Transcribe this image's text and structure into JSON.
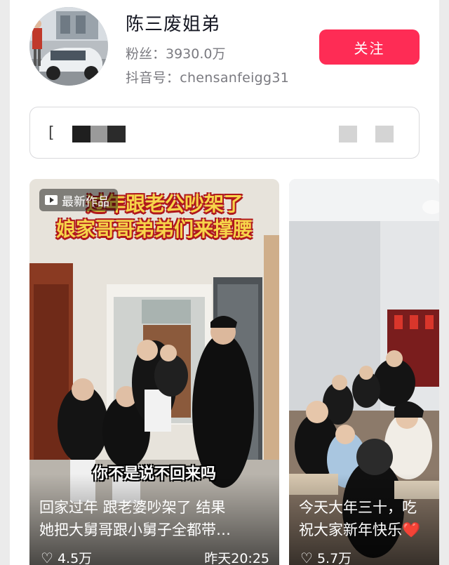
{
  "profile": {
    "nickname": "陈三废姐弟",
    "fans": "粉丝：3930.0万",
    "douyin_id": "抖音号：chensanfeigg31",
    "follow_label": "关注"
  },
  "notice": {
    "bracket": "[",
    "colors": [
      "#1f1f1f",
      "#9a9a9a",
      "#2b2b2b"
    ]
  },
  "videos": [
    {
      "badge": "最新作品",
      "title_line1": "过年跟老公吵架了",
      "title_line2": "娘家哥哥弟弟们来撑腰",
      "subtitle": "你不是说不回来吗",
      "desc_line1": "回家过年 跟老婆吵架了 结果",
      "desc_line2": "她把大舅哥跟小舅子全都带…",
      "likes": "4.5万",
      "time": "昨天20:25"
    },
    {
      "desc_line1": "今天大年三十，吃",
      "desc_line2": "祝大家新年快乐❤️",
      "likes": "5.7万"
    }
  ],
  "colors": {
    "accent": "#fe2c55",
    "title_yellow": "#f6d44a",
    "title_outline": "#b0181c"
  },
  "icons": {
    "badge": "play-icon",
    "likes": "heart-icon"
  }
}
